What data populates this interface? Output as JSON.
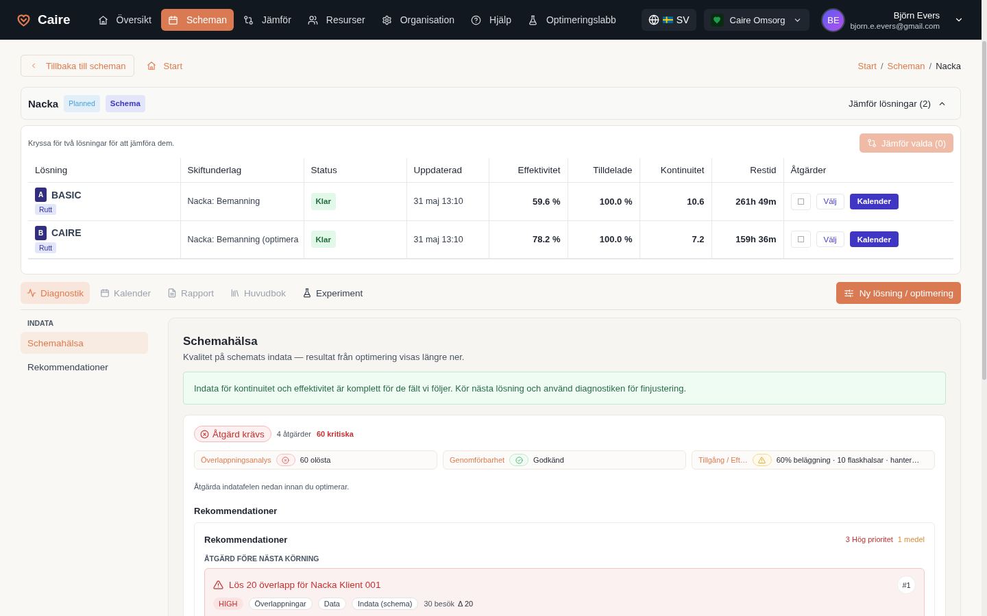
{
  "nav": {
    "logo": "Caire",
    "items": [
      {
        "label": "Översikt",
        "selected": false
      },
      {
        "label": "Scheman",
        "selected": true
      },
      {
        "label": "Jämför",
        "selected": false
      },
      {
        "label": "Resurser",
        "selected": false
      },
      {
        "label": "Organisation",
        "selected": false
      },
      {
        "label": "Hjälp",
        "selected": false
      },
      {
        "label": "Optimeringslabb",
        "selected": false
      }
    ],
    "language": "SV",
    "organization": "Caire Omsorg",
    "user": {
      "initials": "BE",
      "name": "Björn Evers",
      "email": "bjorn.e.evers@gmail.com"
    }
  },
  "toolbar": {
    "back": "Tillbaka till scheman",
    "home": "Start",
    "breadcrumbs": [
      {
        "label": "Start",
        "current": false
      },
      {
        "label": "Scheman",
        "current": false
      },
      {
        "label": "Nacka",
        "current": true
      }
    ],
    "separators": [
      "/",
      "/"
    ]
  },
  "schedule": {
    "title": "Nacka",
    "badges": [
      {
        "label": "Planned",
        "kind": "status"
      },
      {
        "label": "Schema",
        "kind": "type"
      }
    ],
    "compare_toggle": {
      "label": "Jämför lösningar (2)",
      "expanded": true
    }
  },
  "solutions": {
    "hint": "Kryssa för två lösningar för att jämföra dem.",
    "compare_button": {
      "label": "Jämför valda (0)",
      "disabled": true
    },
    "columns": [
      "Lösning",
      "Skiftunderlag",
      "Status",
      "Uppdaterad",
      "Effektivitet",
      "Tilldelade",
      "Kontinuitet",
      "Restid",
      "Åtgärder"
    ],
    "rows": [
      {
        "letter": "A",
        "name": "BASIC",
        "tag": "Rutt",
        "shift_base": "Nacka: Bemanning",
        "status": {
          "label": "Klar",
          "kind": "done"
        },
        "updated": "31 maj 13:10",
        "efficiency": "59.6 %",
        "assigned": "100.0 %",
        "continuity": "10.6",
        "travel_time": "261h 49m",
        "checked": false,
        "select": "Välj",
        "calendar": "Kalender"
      },
      {
        "letter": "B",
        "name": "CAIRE",
        "tag": "Rutt",
        "shift_base": "Nacka: Bemanning (optimera",
        "status": {
          "label": "Klar",
          "kind": "done"
        },
        "updated": "31 maj 13:10",
        "efficiency": "78.2 %",
        "assigned": "100.0 %",
        "continuity": "7.2",
        "travel_time": "159h 36m",
        "checked": false,
        "select": "Välj",
        "calendar": "Kalender"
      }
    ]
  },
  "tabs": {
    "items": [
      {
        "label": "Diagnostik",
        "selected": true,
        "disabled": false
      },
      {
        "label": "Kalender",
        "selected": false,
        "disabled": true
      },
      {
        "label": "Rapport",
        "selected": false,
        "disabled": true
      },
      {
        "label": "Huvudbok",
        "selected": false,
        "disabled": true
      },
      {
        "label": "Experiment",
        "selected": false,
        "disabled": false
      }
    ],
    "new_button": "Ny lösning / optimering"
  },
  "sidebar": {
    "section": "INDATA",
    "items": [
      {
        "label": "Schemahälsa",
        "selected": true
      },
      {
        "label": "Rekommendationer",
        "selected": false
      }
    ]
  },
  "health": {
    "title": "Schemahälsa",
    "subtitle": "Kvalitet på schemats indata — resultat från optimering visas längre ner.",
    "notice": "Indata för kontinuitet och effektivitet är komplett för de fält vi följer. Kör nästa lösning och använd diagnostiken för finjustering.",
    "summary": {
      "status": {
        "label": "Åtgärd krävs",
        "kind": "error"
      },
      "counts": [
        {
          "label": "4 åtgärder",
          "kind": "neutral"
        },
        {
          "label": "60 kritiska",
          "kind": "critical"
        }
      ]
    },
    "checks": [
      {
        "label": "Överlappningsanalys",
        "kind": "error",
        "value": "60 olösta"
      },
      {
        "label": "Genomförbarhet",
        "kind": "ok",
        "value": "Godkänd"
      },
      {
        "label": "Tillgång / Eft…",
        "kind": "warning",
        "value": "60% beläggning · 10 flaskhalsar · hanter…"
      }
    ],
    "advice": "Åtgärda indatafelen nedan innan du optimerar.",
    "heading": "Rekommendationer"
  },
  "recommendations": {
    "title": "Rekommendationer",
    "counts": [
      {
        "label": "3 Hög prioritet",
        "kind": "high"
      },
      {
        "label": "1 medel",
        "kind": "medium"
      }
    ],
    "section": "ÅTGÄRD FÖRE NÄSTA KÖRNING",
    "items": [
      {
        "title": "Lös 20 överlapp för Nacka Klient 001",
        "rank": "#1",
        "kind": "high",
        "priority": "HIGH",
        "tags": [
          "Överlappningar",
          "Data",
          "Indata (schema)"
        ],
        "visits": "30 besök",
        "delta": "Δ 20"
      }
    ]
  }
}
